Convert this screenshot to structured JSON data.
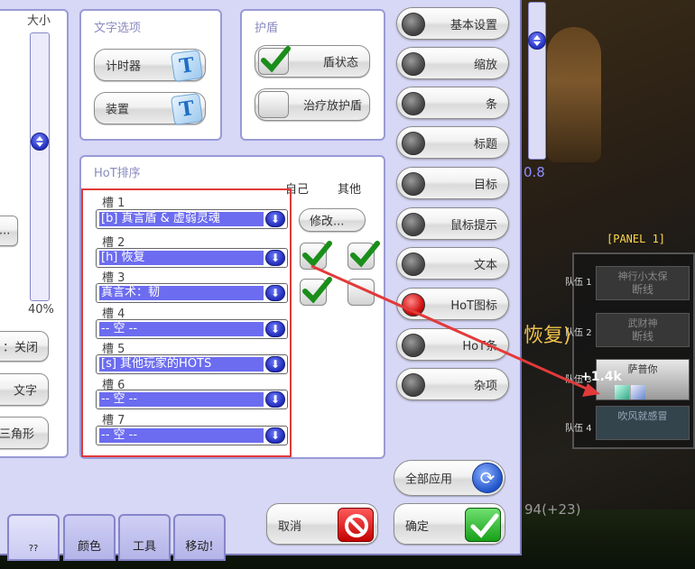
{
  "size_label": "大小",
  "size_value": "40%",
  "size_level": 0.4,
  "left_buttons": {
    "close_partial": "：关闭",
    "text": "文字",
    "triangle": "三角形",
    "dots": "..."
  },
  "text_options": {
    "title": "文字选项",
    "timer": "计时器",
    "device": "装置"
  },
  "shield": {
    "title": "护盾",
    "shield_state": "盾状态",
    "heal_shield": "治疗放护盾",
    "shield_state_checked": true,
    "heal_shield_checked": false
  },
  "hot_order": {
    "title": "HoT排序",
    "self_label": "自己",
    "other_label": "其他",
    "modify_label": "修改...",
    "slots": [
      {
        "label": "槽 1",
        "value": "[b] 真言盾 & 虚弱灵魂"
      },
      {
        "label": "槽 2",
        "value": "[h] 恢复"
      },
      {
        "label": "槽 3",
        "value": "真言术：韧"
      },
      {
        "label": "槽 4",
        "value": "-- 空 --"
      },
      {
        "label": "槽 5",
        "value": "[s] 其他玩家的HOTS"
      },
      {
        "label": "槽 6",
        "value": "-- 空 --"
      },
      {
        "label": "槽 7",
        "value": "-- 空 --"
      }
    ],
    "checks": {
      "row1_self": true,
      "row1_other": true,
      "row2_self": true,
      "row2_other": false
    }
  },
  "nav": [
    {
      "label": "基本设置",
      "active": false
    },
    {
      "label": "缩放",
      "active": false
    },
    {
      "label": "条",
      "active": false
    },
    {
      "label": "标题",
      "active": false
    },
    {
      "label": "目标",
      "active": false
    },
    {
      "label": "鼠标提示",
      "active": false
    },
    {
      "label": "文本",
      "active": false
    },
    {
      "label": "HoT图标",
      "active": true
    },
    {
      "label": "HoT条",
      "active": false
    },
    {
      "label": "杂项",
      "active": false
    }
  ],
  "apply_all": "全部应用",
  "cancel": "取消",
  "ok": "确定",
  "tabs": [
    "??",
    "颜色",
    "工具",
    "移动!"
  ],
  "game": {
    "scale_value": "0.8",
    "panel_label": "[PANEL 1]",
    "recover_text": "恢复)",
    "stat_text": "94(+23)",
    "party_label": "队伍",
    "party_numbers": [
      "1",
      "2",
      "3",
      "4"
    ],
    "units": [
      {
        "name": "神行小太保",
        "status": "断线"
      },
      {
        "name": "武财神",
        "status": "断线"
      },
      {
        "name": "萨普你",
        "status": ""
      },
      {
        "name": "吹风就感冒",
        "status": ""
      }
    ],
    "heal_value": "+1.4k"
  },
  "colors": {
    "dialog_bg": "#d7d7f6",
    "slot_fill": "#6c6cf0",
    "annotation": "#e23a3a",
    "panel_border": "#9a9ad6"
  }
}
